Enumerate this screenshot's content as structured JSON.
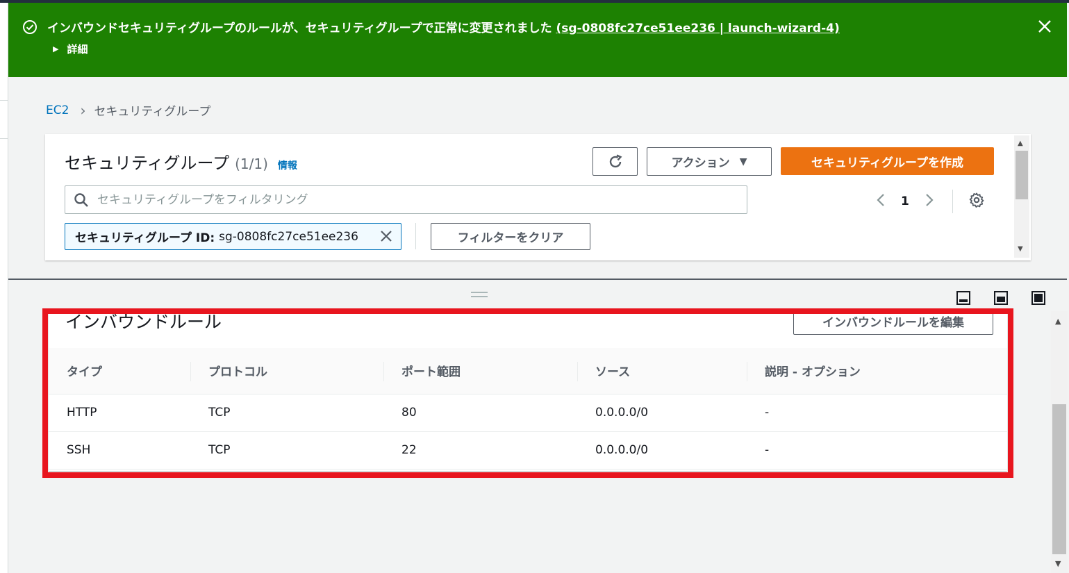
{
  "flash": {
    "message": "インバウンドセキュリティグループのルールが、セキュリティグループで正常に変更されました",
    "link": "(sg-0808fc27ce51ee236 | launch-wizard-4)",
    "details_label": "詳細",
    "status_color": "#1d8102"
  },
  "breadcrumb": {
    "root": "EC2",
    "current": "セキュリティグループ"
  },
  "sg_panel": {
    "title": "セキュリティグループ",
    "count": "(1/1)",
    "info": "情報",
    "actions_label": "アクション",
    "create_label": "セキュリティグループを作成",
    "search_placeholder": "セキュリティグループをフィルタリング",
    "page_number": "1",
    "filter_token_key": "セキュリティグループ ID:",
    "filter_token_value": "sg-0808fc27ce51ee236",
    "clear_filters_label": "フィルターをクリア",
    "accent_color": "#ec7211"
  },
  "inbound": {
    "title": "インバウンドルール",
    "edit_label": "インバウンドルールを編集",
    "columns": [
      "タイプ",
      "プロトコル",
      "ポート範囲",
      "ソース",
      "説明 - オプション"
    ],
    "rows": [
      [
        "HTTP",
        "TCP",
        "80",
        "0.0.0.0/0",
        "-"
      ],
      [
        "SSH",
        "TCP",
        "22",
        "0.0.0.0/0",
        "-"
      ]
    ]
  },
  "icons": {
    "flash_status": "check-circle-icon",
    "flash_close": "close-icon",
    "refresh": "refresh-icon",
    "dropdown": "caret-down-icon",
    "search": "search-icon",
    "settings": "gear-icon"
  }
}
